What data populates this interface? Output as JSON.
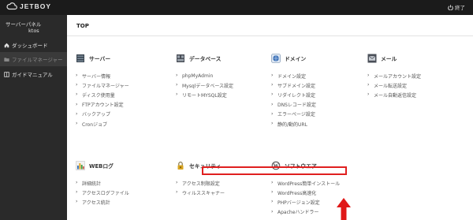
{
  "app": {
    "logo_text": "JETBOY",
    "logout_label": "終了"
  },
  "sidebar": {
    "panel_title": "サーバーパネル",
    "username": "ktos",
    "items": [
      {
        "label": "ダッシュボード",
        "icon": "home-icon",
        "active": false
      },
      {
        "label": "ファイルマネージャー",
        "icon": "folder-icon",
        "active": true
      },
      {
        "label": "ガイドマニュアル",
        "icon": "book-icon",
        "active": false
      }
    ]
  },
  "main": {
    "title": "TOP",
    "categories": [
      {
        "name": "サーバー",
        "icon": "server-icon",
        "items": [
          "サーバー情報",
          "ファイルマネージャー",
          "ディスク使用量",
          "FTPアカウント設定",
          "バックアップ",
          "Cronジョブ"
        ]
      },
      {
        "name": "データベース",
        "icon": "database-icon",
        "items": [
          "phpMyAdmin",
          "Mysqlデータベース設定",
          "リモートMYSQL設定"
        ]
      },
      {
        "name": "ドメイン",
        "icon": "globe-icon",
        "items": [
          "ドメイン設定",
          "サブドメイン設定",
          "リダイレクト設定",
          "DNSレコード設定",
          "エラーページ設定",
          "静的/動的URL"
        ]
      },
      {
        "name": "メール",
        "icon": "mail-icon",
        "items": [
          "メールアカウント設定",
          "メール転送設定",
          "メール自動返信設定"
        ]
      },
      {
        "name": "WEBログ",
        "icon": "bar-chart-icon",
        "items": [
          "詳細統計",
          "アクセスログファイル",
          "アクセス統計"
        ]
      },
      {
        "name": "セキュリティ",
        "icon": "lock-icon",
        "items": [
          "アクセス制限設定",
          "ウィルススキャナー"
        ]
      },
      {
        "name": "ソフトウエア",
        "icon": "wordpress-icon",
        "items": [
          "WordPress簡単インストール",
          "WordPress高速化",
          "PHPバージョン設定",
          "Apacheハンドラー"
        ]
      }
    ]
  },
  "colors": {
    "topbar": "#1b1b1b",
    "sidebar": "#2a2a2a",
    "highlight": "#e02020",
    "arrow": "#e01818"
  }
}
